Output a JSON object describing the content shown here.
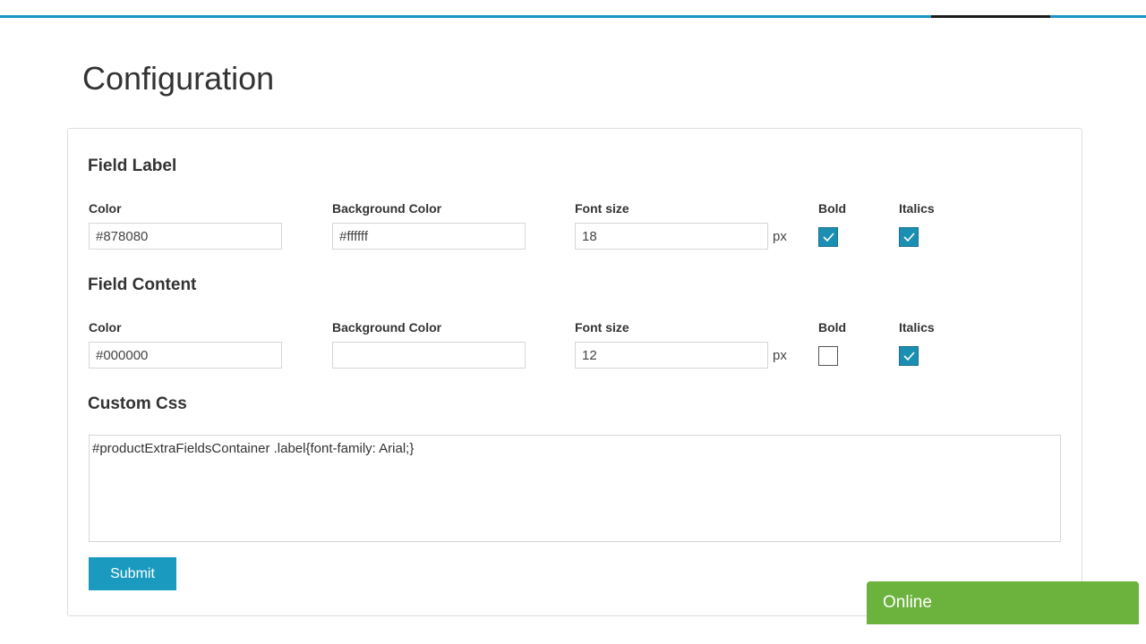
{
  "page": {
    "title": "Configuration"
  },
  "field_label": {
    "heading": "Field Label",
    "color": {
      "label": "Color",
      "value": "#878080"
    },
    "background_color": {
      "label": "Background Color",
      "value": "#ffffff"
    },
    "font_size": {
      "label": "Font size",
      "value": "18",
      "unit": "px"
    },
    "bold": {
      "label": "Bold",
      "checked": true
    },
    "italics": {
      "label": "Italics",
      "checked": true
    }
  },
  "field_content": {
    "heading": "Field Content",
    "color": {
      "label": "Color",
      "value": "#000000"
    },
    "background_color": {
      "label": "Background Color",
      "value": ""
    },
    "font_size": {
      "label": "Font size",
      "value": "12",
      "unit": "px"
    },
    "bold": {
      "label": "Bold",
      "checked": false
    },
    "italics": {
      "label": "Italics",
      "checked": true
    }
  },
  "custom_css": {
    "heading": "Custom Css",
    "value": "#productExtraFieldsContainer .label{font-family: Arial;}"
  },
  "submit": {
    "label": "Submit"
  },
  "chat": {
    "label": "Online"
  },
  "colors": {
    "accent": "#1b9ac0",
    "chat": "#6cb33e"
  }
}
